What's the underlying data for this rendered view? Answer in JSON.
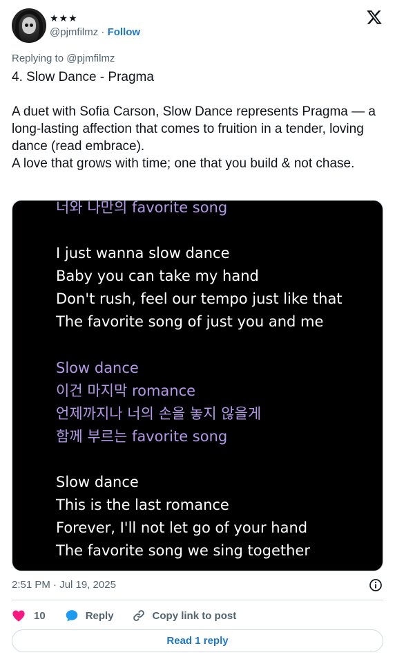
{
  "author": {
    "display_name": "★★★",
    "handle": "@pjmfilmz",
    "separator": " · ",
    "follow_label": "Follow"
  },
  "replying_to": "Replying to @pjmfilmz",
  "tweet_text": "4. Slow Dance - Pragma\n\nA duet with Sofia Carson, Slow Dance represents Pragma — a long-lasting affection that comes to fruition in a tender, loving dance (read embrace).\nA love that grows with time; one that you build & not chase.",
  "media": {
    "lyrics": [
      {
        "text": "너와 나만의 favorite song",
        "color": "#b497e8"
      },
      {
        "text": "I just wanna slow dance",
        "color": "#ffffff"
      },
      {
        "text": "Baby you can take my hand",
        "color": "#ffffff"
      },
      {
        "text": "Don't rush, feel our tempo just like that",
        "color": "#ffffff"
      },
      {
        "text": "The favorite song of just you and me",
        "color": "#ffffff"
      },
      {
        "text": "Slow dance",
        "color": "#b497e8"
      },
      {
        "text": "이건 마지막 romance",
        "color": "#b497e8"
      },
      {
        "text": "언제까지나 너의 손을 놓지 않을게",
        "color": "#b497e8"
      },
      {
        "text": "함께 부르는 favorite song",
        "color": "#b497e8"
      },
      {
        "text": "Slow dance",
        "color": "#ffffff"
      },
      {
        "text": "This is the last romance",
        "color": "#ffffff"
      },
      {
        "text": "Forever, I'll not let go of your hand",
        "color": "#ffffff"
      },
      {
        "text": "The favorite song we sing together",
        "color": "#ffffff"
      }
    ]
  },
  "timestamp": "2:51 PM · Jul 19, 2025",
  "actions": {
    "like_count": "10",
    "reply_label": "Reply",
    "copy_link_label": "Copy link to post"
  },
  "read_reply_label": "Read 1 reply",
  "colors": {
    "accent": "#1d77c8",
    "like": "#f91880",
    "reply_icon": "#1d9bf0",
    "muted": "#536471",
    "lyric_purple": "#b497e8"
  },
  "icons": [
    "x-logo-icon",
    "info-icon",
    "heart-icon",
    "reply-bubble-icon",
    "link-icon"
  ]
}
